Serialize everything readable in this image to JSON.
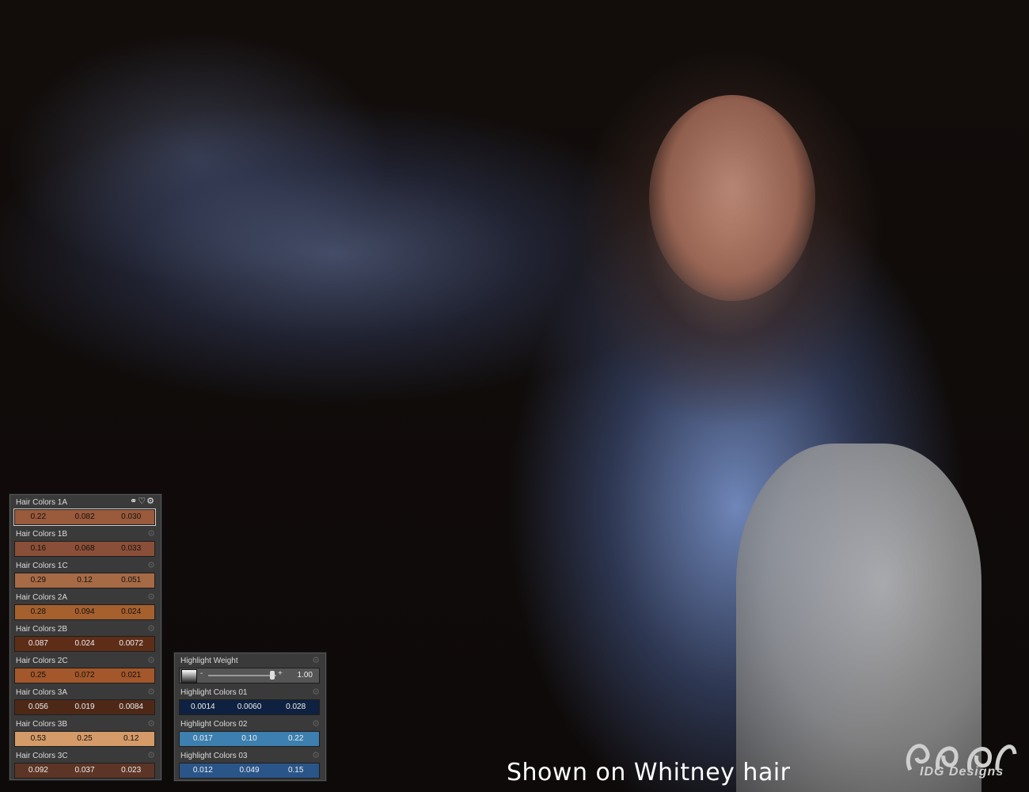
{
  "caption": "Shown on Whitney hair",
  "logo": {
    "text": "IDG Designs"
  },
  "left_panel": {
    "header_icons": [
      "link-icon",
      "heart-icon",
      "gear-icon"
    ],
    "properties": [
      {
        "label": "Hair Colors 1A",
        "values": [
          "0.22",
          "0.082",
          "0.030"
        ],
        "color": "#9a5a3c",
        "selected": true
      },
      {
        "label": "Hair Colors 1B",
        "values": [
          "0.16",
          "0.068",
          "0.033"
        ],
        "color": "#8a4f38"
      },
      {
        "label": "Hair Colors 1C",
        "values": [
          "0.29",
          "0.12",
          "0.051"
        ],
        "color": "#a66a45"
      },
      {
        "label": "Hair Colors 2A",
        "values": [
          "0.28",
          "0.094",
          "0.024"
        ],
        "color": "#a5602e"
      },
      {
        "label": "Hair Colors 2B",
        "values": [
          "0.087",
          "0.024",
          "0.0072"
        ],
        "color": "#5e2d17"
      },
      {
        "label": "Hair Colors 2C",
        "values": [
          "0.25",
          "0.072",
          "0.021"
        ],
        "color": "#a3572a"
      },
      {
        "label": "Hair Colors 3A",
        "values": [
          "0.056",
          "0.019",
          "0.0084"
        ],
        "color": "#4e2817"
      },
      {
        "label": "Hair Colors 3B",
        "values": [
          "0.53",
          "0.25",
          "0.12"
        ],
        "color": "#d49a68"
      },
      {
        "label": "Hair Colors 3C",
        "values": [
          "0.092",
          "0.037",
          "0.023"
        ],
        "color": "#5d3526"
      }
    ]
  },
  "right_panel": {
    "weight": {
      "label": "Highlight Weight",
      "value": "1.00",
      "minus": "-",
      "plus": "+"
    },
    "properties": [
      {
        "label": "Highlight Colors 01",
        "values": [
          "0.0014",
          "0.0060",
          "0.028"
        ],
        "color": "#0f2140"
      },
      {
        "label": "Highlight Colors 02",
        "values": [
          "0.017",
          "0.10",
          "0.22"
        ],
        "color": "#3d7fae"
      },
      {
        "label": "Highlight Colors 03",
        "values": [
          "0.012",
          "0.049",
          "0.15"
        ],
        "color": "#2a5589"
      }
    ]
  }
}
